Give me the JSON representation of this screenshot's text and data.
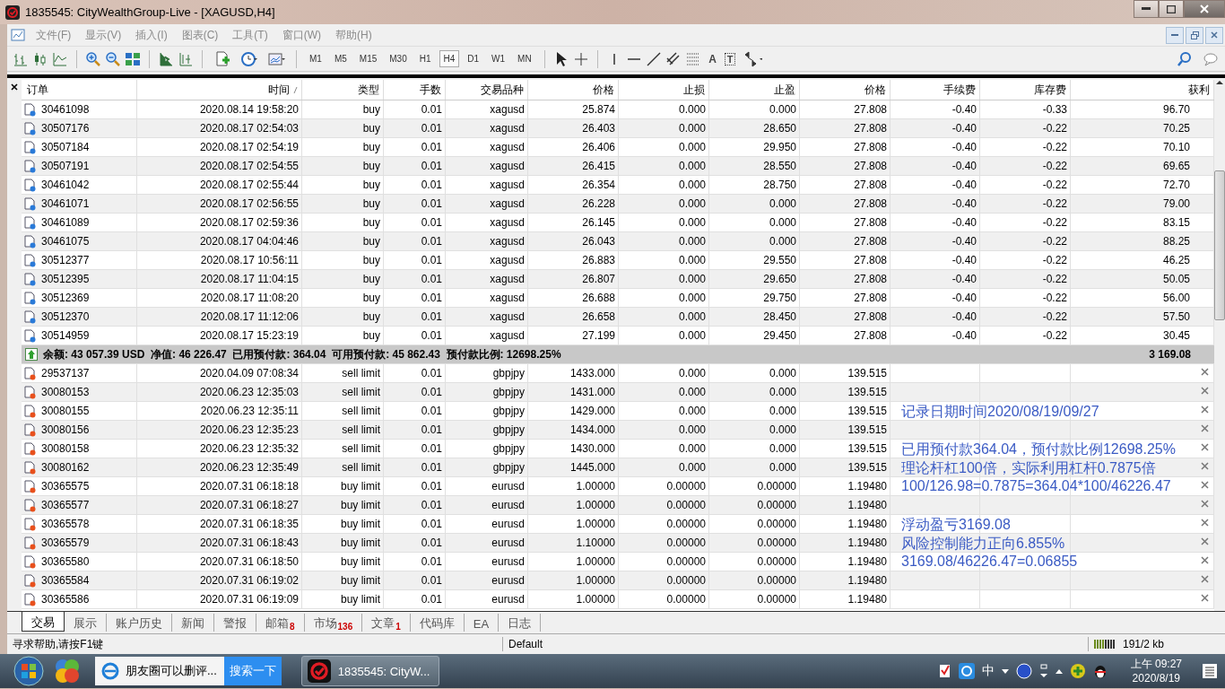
{
  "window": {
    "title": "1835545: CityWealthGroup-Live - [XAGUSD,H4]"
  },
  "menu": [
    "文件(F)",
    "显示(V)",
    "插入(I)",
    "图表(C)",
    "工具(T)",
    "窗口(W)",
    "帮助(H)"
  ],
  "toolbar": {
    "text_tool": "A",
    "label_tool": "T",
    "timeframes": [
      {
        "label": "M1",
        "selected": false
      },
      {
        "label": "M5",
        "selected": false
      },
      {
        "label": "M15",
        "selected": false
      },
      {
        "label": "M30",
        "selected": false
      },
      {
        "label": "H1",
        "selected": false
      },
      {
        "label": "H4",
        "selected": true
      },
      {
        "label": "D1",
        "selected": false
      },
      {
        "label": "W1",
        "selected": false
      },
      {
        "label": "MN",
        "selected": false
      }
    ]
  },
  "table": {
    "columns": [
      {
        "label": "订单",
        "sorted": false
      },
      {
        "label": "时间",
        "sorted": true
      },
      {
        "label": "类型",
        "sorted": false
      },
      {
        "label": "手数",
        "sorted": false
      },
      {
        "label": "交易品种",
        "sorted": false
      },
      {
        "label": "价格",
        "sorted": false
      },
      {
        "label": "止损",
        "sorted": false
      },
      {
        "label": "止盈",
        "sorted": false
      },
      {
        "label": "价格",
        "sorted": false
      },
      {
        "label": "手续费",
        "sorted": false
      },
      {
        "label": "库存费",
        "sorted": false
      },
      {
        "label": "获利",
        "sorted": false
      }
    ],
    "positions": [
      [
        "30461098",
        "2020.08.14 19:58:20",
        "buy",
        "0.01",
        "xagusd",
        "25.874",
        "0.000",
        "0.000",
        "27.808",
        "-0.40",
        "-0.33",
        "96.70"
      ],
      [
        "30507176",
        "2020.08.17 02:54:03",
        "buy",
        "0.01",
        "xagusd",
        "26.403",
        "0.000",
        "28.650",
        "27.808",
        "-0.40",
        "-0.22",
        "70.25"
      ],
      [
        "30507184",
        "2020.08.17 02:54:19",
        "buy",
        "0.01",
        "xagusd",
        "26.406",
        "0.000",
        "29.950",
        "27.808",
        "-0.40",
        "-0.22",
        "70.10"
      ],
      [
        "30507191",
        "2020.08.17 02:54:55",
        "buy",
        "0.01",
        "xagusd",
        "26.415",
        "0.000",
        "28.550",
        "27.808",
        "-0.40",
        "-0.22",
        "69.65"
      ],
      [
        "30461042",
        "2020.08.17 02:55:44",
        "buy",
        "0.01",
        "xagusd",
        "26.354",
        "0.000",
        "28.750",
        "27.808",
        "-0.40",
        "-0.22",
        "72.70"
      ],
      [
        "30461071",
        "2020.08.17 02:56:55",
        "buy",
        "0.01",
        "xagusd",
        "26.228",
        "0.000",
        "0.000",
        "27.808",
        "-0.40",
        "-0.22",
        "79.00"
      ],
      [
        "30461089",
        "2020.08.17 02:59:36",
        "buy",
        "0.01",
        "xagusd",
        "26.145",
        "0.000",
        "0.000",
        "27.808",
        "-0.40",
        "-0.22",
        "83.15"
      ],
      [
        "30461075",
        "2020.08.17 04:04:46",
        "buy",
        "0.01",
        "xagusd",
        "26.043",
        "0.000",
        "0.000",
        "27.808",
        "-0.40",
        "-0.22",
        "88.25"
      ],
      [
        "30512377",
        "2020.08.17 10:56:11",
        "buy",
        "0.01",
        "xagusd",
        "26.883",
        "0.000",
        "29.550",
        "27.808",
        "-0.40",
        "-0.22",
        "46.25"
      ],
      [
        "30512395",
        "2020.08.17 11:04:15",
        "buy",
        "0.01",
        "xagusd",
        "26.807",
        "0.000",
        "29.650",
        "27.808",
        "-0.40",
        "-0.22",
        "50.05"
      ],
      [
        "30512369",
        "2020.08.17 11:08:20",
        "buy",
        "0.01",
        "xagusd",
        "26.688",
        "0.000",
        "29.750",
        "27.808",
        "-0.40",
        "-0.22",
        "56.00"
      ],
      [
        "30512370",
        "2020.08.17 11:12:06",
        "buy",
        "0.01",
        "xagusd",
        "26.658",
        "0.000",
        "28.450",
        "27.808",
        "-0.40",
        "-0.22",
        "57.50"
      ],
      [
        "30514959",
        "2020.08.17 15:23:19",
        "buy",
        "0.01",
        "xagusd",
        "27.199",
        "0.000",
        "29.450",
        "27.808",
        "-0.40",
        "-0.22",
        "30.45"
      ]
    ],
    "summary": {
      "text": "余额: 43 057.39 USD  净值: 46 226.47  已用预付款: 364.04  可用预付款: 45 862.43  预付款比例: 12698.25%",
      "profit": "3 169.08"
    },
    "orders": [
      {
        "cells": [
          "29537137",
          "2020.04.09 07:08:34",
          "sell limit",
          "0.01",
          "gbpjpy",
          "1433.000",
          "0.000",
          "0.000",
          "139.515"
        ]
      },
      {
        "cells": [
          "30080153",
          "2020.06.23 12:35:03",
          "sell limit",
          "0.01",
          "gbpjpy",
          "1431.000",
          "0.000",
          "0.000",
          "139.515"
        ]
      },
      {
        "cells": [
          "30080155",
          "2020.06.23 12:35:11",
          "sell limit",
          "0.01",
          "gbpjpy",
          "1429.000",
          "0.000",
          "0.000",
          "139.515"
        ],
        "note": "记录日期时间2020/08/19/09/27"
      },
      {
        "cells": [
          "30080156",
          "2020.06.23 12:35:23",
          "sell limit",
          "0.01",
          "gbpjpy",
          "1434.000",
          "0.000",
          "0.000",
          "139.515"
        ]
      },
      {
        "cells": [
          "30080158",
          "2020.06.23 12:35:32",
          "sell limit",
          "0.01",
          "gbpjpy",
          "1430.000",
          "0.000",
          "0.000",
          "139.515"
        ],
        "note": "已用预付款364.04，预付款比例12698.25%"
      },
      {
        "cells": [
          "30080162",
          "2020.06.23 12:35:49",
          "sell limit",
          "0.01",
          "gbpjpy",
          "1445.000",
          "0.000",
          "0.000",
          "139.515"
        ],
        "note": "理论杆杠100倍，实际利用杠杆0.7875倍"
      },
      {
        "cells": [
          "30365575",
          "2020.07.31 06:18:18",
          "buy limit",
          "0.01",
          "eurusd",
          "1.00000",
          "0.00000",
          "0.00000",
          "1.19480"
        ],
        "note": "100/126.98=0.7875=364.04*100/46226.47"
      },
      {
        "cells": [
          "30365577",
          "2020.07.31 06:18:27",
          "buy limit",
          "0.01",
          "eurusd",
          "1.00000",
          "0.00000",
          "0.00000",
          "1.19480"
        ]
      },
      {
        "cells": [
          "30365578",
          "2020.07.31 06:18:35",
          "buy limit",
          "0.01",
          "eurusd",
          "1.00000",
          "0.00000",
          "0.00000",
          "1.19480"
        ],
        "note": "浮动盈亏3169.08"
      },
      {
        "cells": [
          "30365579",
          "2020.07.31 06:18:43",
          "buy limit",
          "0.01",
          "eurusd",
          "1.10000",
          "0.00000",
          "0.00000",
          "1.19480"
        ],
        "note": "风险控制能力正向6.855%"
      },
      {
        "cells": [
          "30365580",
          "2020.07.31 06:18:50",
          "buy limit",
          "0.01",
          "eurusd",
          "1.00000",
          "0.00000",
          "0.00000",
          "1.19480"
        ],
        "note": "3169.08/46226.47=0.06855"
      },
      {
        "cells": [
          "30365584",
          "2020.07.31 06:19:02",
          "buy limit",
          "0.01",
          "eurusd",
          "1.00000",
          "0.00000",
          "0.00000",
          "1.19480"
        ]
      },
      {
        "cells": [
          "30365586",
          "2020.07.31 06:19:09",
          "buy limit",
          "0.01",
          "eurusd",
          "1.00000",
          "0.00000",
          "0.00000",
          "1.19480"
        ]
      }
    ]
  },
  "tabs": [
    {
      "label": "交易",
      "selected": true
    },
    {
      "label": "展示",
      "selected": false
    },
    {
      "label": "账户历史",
      "selected": false
    },
    {
      "label": "新闻",
      "selected": false
    },
    {
      "label": "警报",
      "selected": false
    },
    {
      "label": "邮箱",
      "badge": "8",
      "selected": false
    },
    {
      "label": "市场",
      "badge": "136",
      "selected": false
    },
    {
      "label": "文章",
      "badge": "1",
      "selected": false
    },
    {
      "label": "代码库",
      "selected": false
    },
    {
      "label": "EA",
      "selected": false
    },
    {
      "label": "日志",
      "selected": false
    }
  ],
  "status_bar": {
    "help": "寻求帮助,请按F1键",
    "profile": "Default",
    "traffic": "191/2 kb"
  },
  "taskbar": {
    "browser_text": "朋友圈可以删评...",
    "search_button": "搜索一下",
    "app": "1835545: CityW...",
    "ime": "中",
    "time": "上午 09:27",
    "date": "2020/8/19"
  }
}
